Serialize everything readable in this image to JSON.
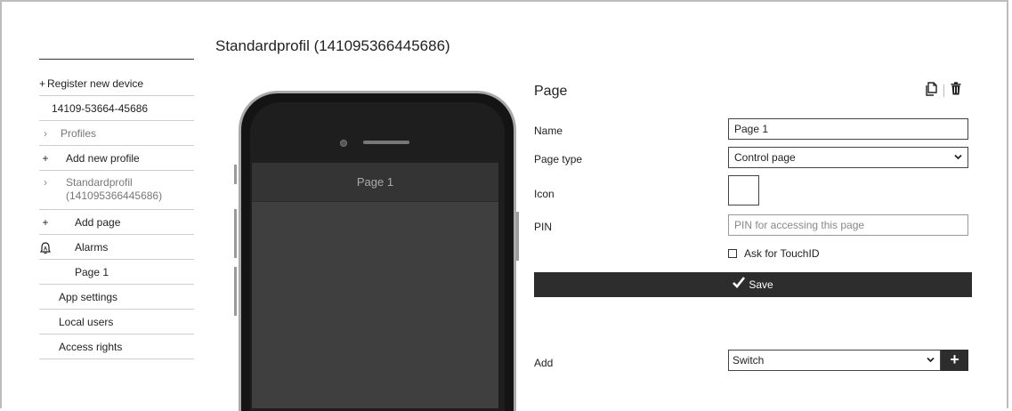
{
  "page_heading": "Standardprofil (141095366445686)",
  "sidebar": {
    "items": [
      {
        "prefix": "+",
        "label": "Register new device"
      },
      {
        "prefix": "",
        "label": "14109-53664-45686"
      },
      {
        "prefix": "›",
        "label": "Profiles"
      },
      {
        "prefix": "+",
        "label": "Add new profile"
      },
      {
        "prefix": "›",
        "label": "Standardprofil",
        "label2": "(141095366445686)"
      },
      {
        "prefix": "+",
        "label": "Add page"
      },
      {
        "prefix": "alarm-icon",
        "label": "Alarms"
      },
      {
        "prefix": "",
        "label": "Page 1"
      },
      {
        "prefix": "",
        "label": "App settings"
      },
      {
        "prefix": "",
        "label": "Local users"
      },
      {
        "prefix": "",
        "label": "Access rights"
      }
    ]
  },
  "phone": {
    "screen_title": "Page 1"
  },
  "form": {
    "title": "Page",
    "name_label": "Name",
    "name_value": "Page 1",
    "page_type_label": "Page type",
    "page_type_value": "Control page",
    "icon_label": "Icon",
    "pin_label": "PIN",
    "pin_placeholder": "PIN for accessing this page",
    "touchid_label": "Ask for TouchID",
    "save_label": "Save",
    "add_label": "Add",
    "add_value": "Switch",
    "add_button": "+"
  },
  "icons": {
    "copy": "copy-icon",
    "delete": "trash-icon",
    "alarm": "alarm-icon",
    "check": "checkmark-icon",
    "dropdown": "chevron-down-icon"
  }
}
